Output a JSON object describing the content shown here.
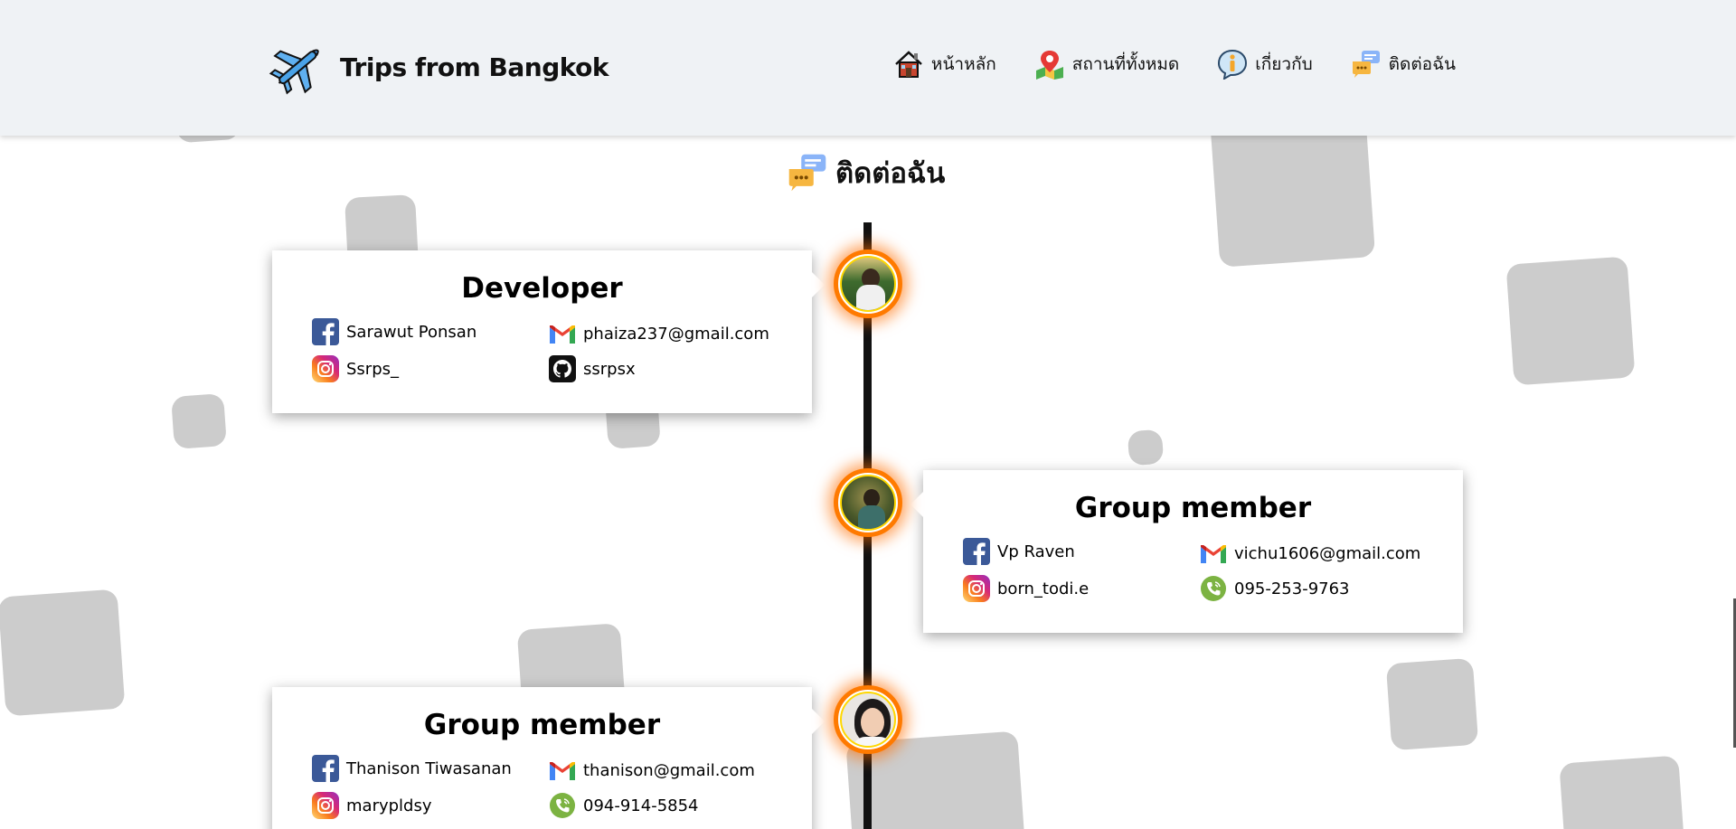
{
  "header": {
    "brand_title": "Trips from Bangkok",
    "nav": [
      {
        "label": "หน้าหลัก",
        "icon": "house-icon"
      },
      {
        "label": "สถานที่ทั้งหมด",
        "icon": "map-pin-icon"
      },
      {
        "label": "เกี่ยวกับ",
        "icon": "info-icon"
      },
      {
        "label": "ติดต่อฉัน",
        "icon": "chat-bubbles-icon"
      }
    ]
  },
  "section": {
    "title": "ติดต่อฉัน",
    "icon": "chat-bubbles-icon"
  },
  "cards": [
    {
      "title": "Developer",
      "contacts": [
        {
          "type": "facebook",
          "icon": "facebook-icon",
          "text": "Sarawut Ponsan"
        },
        {
          "type": "gmail",
          "icon": "gmail-icon",
          "text": "phaiza237@gmail.com"
        },
        {
          "type": "instagram",
          "icon": "instagram-icon",
          "text": "Ssrps_"
        },
        {
          "type": "github",
          "icon": "github-icon",
          "text": "ssrpsx"
        }
      ]
    },
    {
      "title": "Group member",
      "contacts": [
        {
          "type": "facebook",
          "icon": "facebook-icon",
          "text": "Vp Raven"
        },
        {
          "type": "gmail",
          "icon": "gmail-icon",
          "text": "vichu1606@gmail.com"
        },
        {
          "type": "instagram",
          "icon": "instagram-icon",
          "text": "born_todi.e"
        },
        {
          "type": "phone",
          "icon": "phone-icon",
          "text": "095-253-9763"
        }
      ]
    },
    {
      "title": "Group member",
      "contacts": [
        {
          "type": "facebook",
          "icon": "facebook-icon",
          "text": "Thanison Tiwasanan"
        },
        {
          "type": "gmail",
          "icon": "gmail-icon",
          "text": "thanison@gmail.com"
        },
        {
          "type": "instagram",
          "icon": "instagram-icon",
          "text": "marypldsy"
        },
        {
          "type": "phone",
          "icon": "phone-icon",
          "text": "094-914-5854"
        }
      ]
    }
  ],
  "colors": {
    "header_bg": "#eff2f5",
    "avatar_ring": "#ff7a00",
    "background_squares": "#cccccc"
  }
}
